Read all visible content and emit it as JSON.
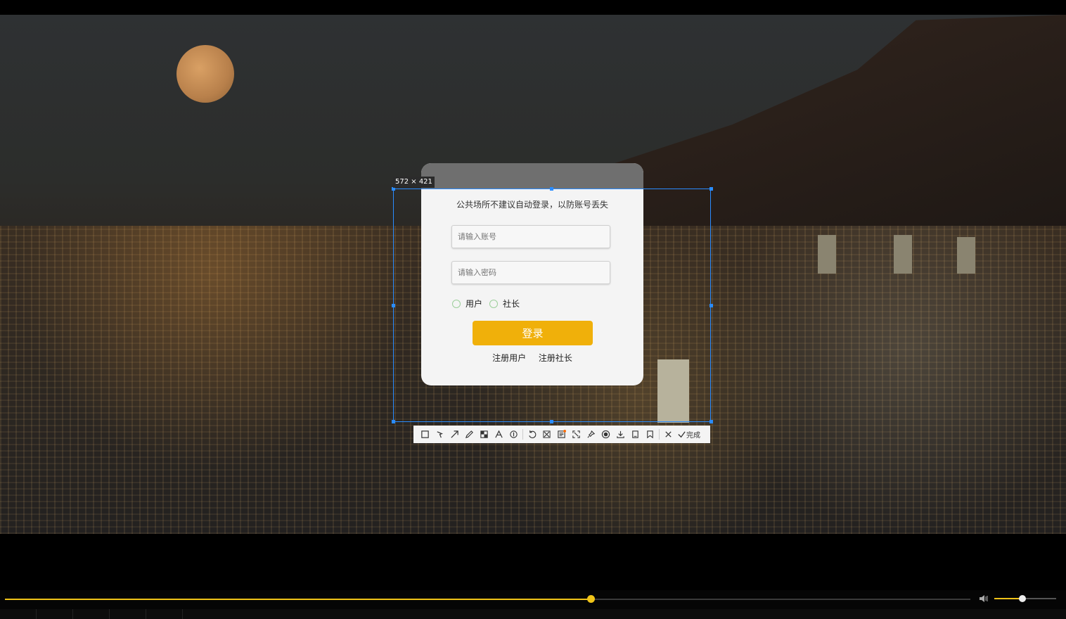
{
  "screenshot_tool": {
    "size_label": "572 × 421",
    "done_label": "完成",
    "tools": [
      "rectangle-icon",
      "lasso-icon",
      "arrow-icon",
      "pen-icon",
      "mosaic-icon",
      "text-icon",
      "number-icon",
      "undo-icon",
      "crop-icon",
      "ocr-icon",
      "scan-icon",
      "pin-icon",
      "record-icon",
      "download-icon",
      "save-icon",
      "bookmark-icon",
      "close-icon"
    ]
  },
  "login": {
    "notice": "公共场所不建议自动登录，以防账号丢失",
    "account_placeholder": "请输入账号",
    "password_placeholder": "请输入密码",
    "role_user": "用户",
    "role_admin": "社长",
    "login_button": "登录",
    "register_user": "注册用户",
    "register_admin": "注册社长"
  },
  "player": {
    "progress": 0.607,
    "volume": 0.45
  }
}
